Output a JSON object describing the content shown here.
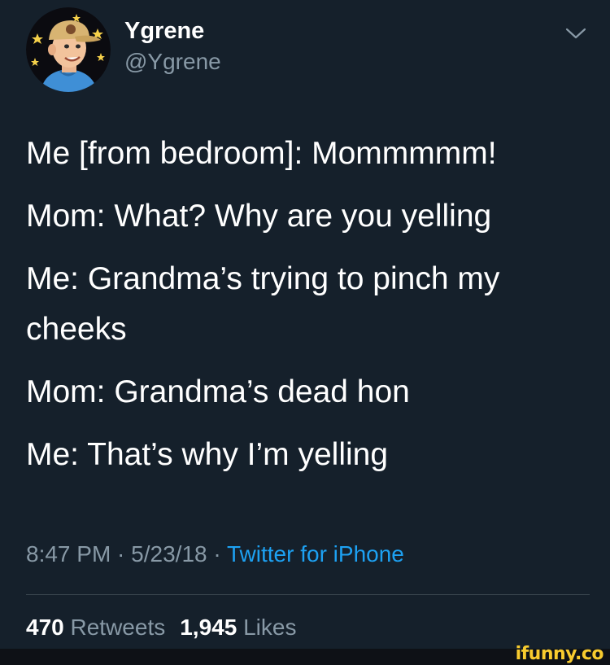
{
  "author": {
    "display_name": "Ygrene",
    "handle": "@Ygrene",
    "avatar_icon": "cartoon-avatar-cap-stars"
  },
  "tweet": {
    "lines": [
      "Me [from bedroom]: Mommmmm!",
      "Mom: What? Why are you yelling",
      "Me: Grandma’s trying to pinch my",
      "cheeks",
      "Mom: Grandma’s dead hon",
      "Me: That’s why I’m yelling"
    ]
  },
  "meta": {
    "time": "8:47 PM",
    "date": "5/23/18",
    "separator": " · ",
    "source": "Twitter for iPhone"
  },
  "stats": {
    "retweets_count": "470",
    "retweets_label": "Retweets",
    "likes_count": "1,945",
    "likes_label": "Likes"
  },
  "watermark": "ifunny.co",
  "colors": {
    "background": "#15202b",
    "text_primary": "#ffffff",
    "text_secondary": "#8899a6",
    "link": "#1da1f2",
    "watermark": "#f8cb2e"
  }
}
